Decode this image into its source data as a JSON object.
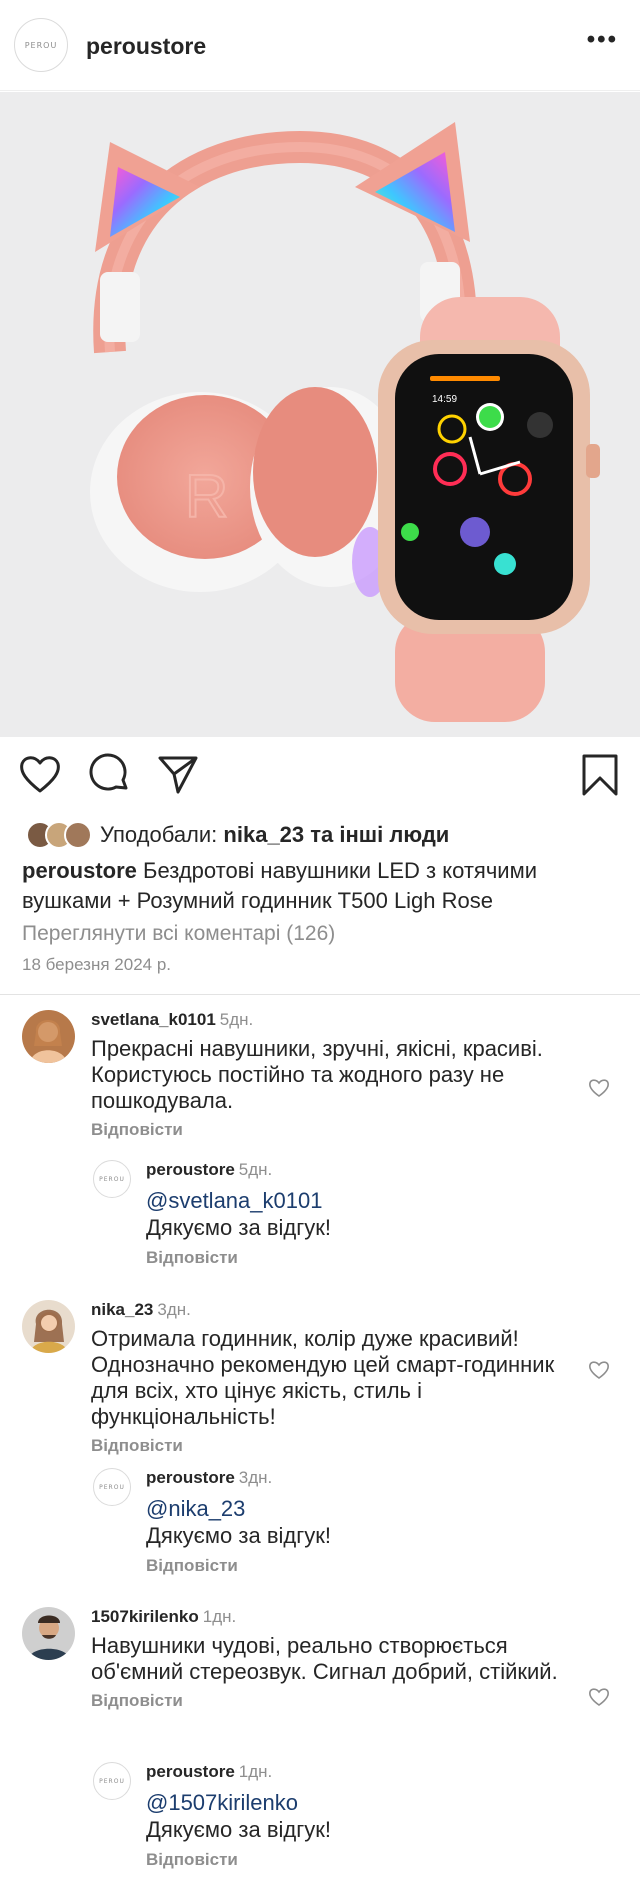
{
  "header": {
    "logo_text": "PEROU",
    "username": "peroustore",
    "more": "•••"
  },
  "photo": {
    "alt": "product-photo-headphones-and-watch",
    "watch_time": "14:59"
  },
  "likes": {
    "prefix": "Уподобали:",
    "user": "nika_23",
    "suffix": "та інші люди"
  },
  "caption": {
    "username": "peroustore",
    "text": "Бездротові навушники LED з котячими вушками + Розумний годинник T500 Ligh Rose"
  },
  "view_all": "Переглянути всі коментарі (126)",
  "date": "18 березня 2024 р.",
  "reply_label": "Відповісти",
  "comments": [
    {
      "user": "svetlana_k0101",
      "time": "5дн.",
      "text": "Прекрасні навушники, зручні, якісні, красиві. Користуюсь постійно та жодного разу не пошкодувала.",
      "reply": {
        "user": "peroustore",
        "time": "5дн.",
        "mention": "@svetlana_k0101",
        "text": "Дякуємо за відгук!"
      }
    },
    {
      "user": "nika_23",
      "time": "3дн.",
      "text": "Отримала годинник, колір дуже красивий! Однозначно рекомендую цей смарт-годинник для всіх, хто цінує якість, стиль і функціональність!",
      "reply": {
        "user": "peroustore",
        "time": "3дн.",
        "mention": "@nika_23",
        "text": "Дякуємо за відгук!"
      }
    },
    {
      "user": "1507kirilenko",
      "time": "1дн.",
      "text": "Навушники чудові, реально створюється об'ємний стереозвук. Сигнал добрий, стійкий.",
      "reply": {
        "user": "peroustore",
        "time": "1дн.",
        "mention": "@1507kirilenko",
        "text": "Дякуємо за відгук!"
      }
    }
  ]
}
